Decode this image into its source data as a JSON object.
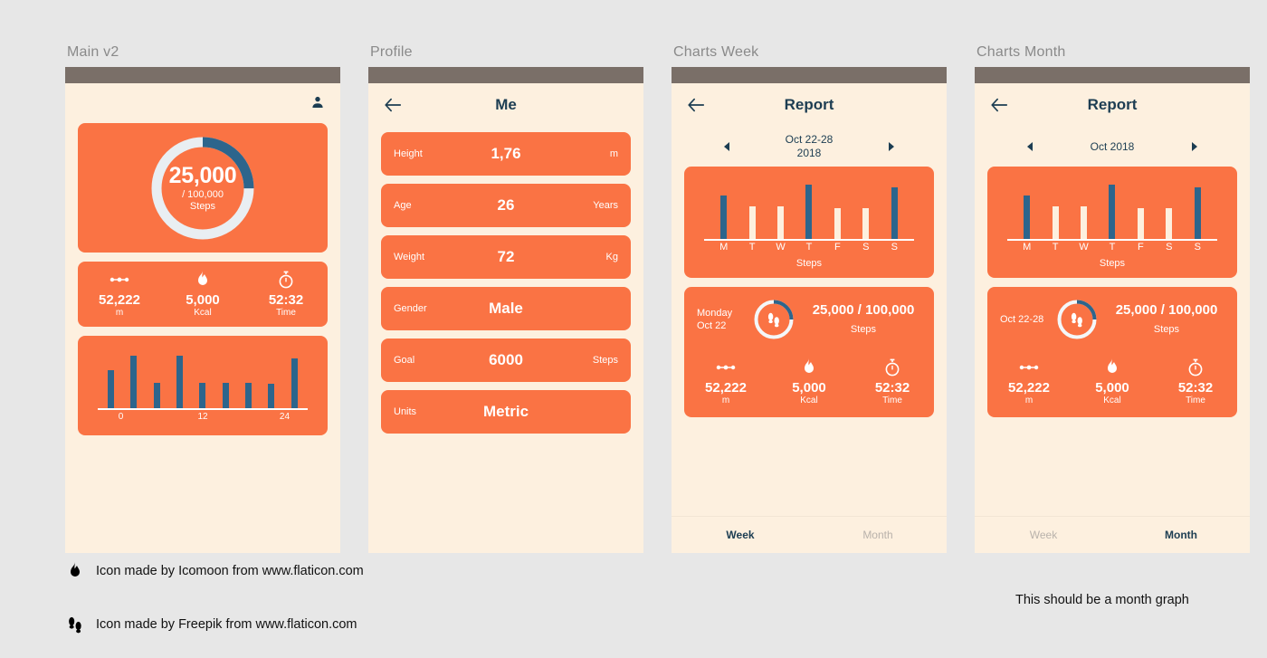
{
  "colors": {
    "background": "#e7e7e7",
    "phone_bg": "#fdf0df",
    "statusbar": "#7a6f68",
    "card_orange": "#fa7344",
    "accent_blue": "#2d658c",
    "navy_text": "#1c3d52",
    "muted_tab": "#b9b2ab"
  },
  "screens": [
    {
      "label": "Main v2",
      "profile_icon": "person-icon",
      "donut": {
        "value": "25,000",
        "goal": "/ 100,000",
        "unit": "Steps",
        "percent": 25
      },
      "stats": [
        {
          "icon": "distance-icon",
          "value": "52,222",
          "unit": "m"
        },
        {
          "icon": "flame-icon",
          "value": "5,000",
          "unit": "Kcal"
        },
        {
          "icon": "stopwatch-icon",
          "value": "52:32",
          "unit": "Time"
        }
      ]
    },
    {
      "label": "Profile",
      "nav": {
        "back": "back-arrow-icon",
        "title": "Me"
      },
      "rows": [
        {
          "label": "Height",
          "value": "1,76",
          "unit": "m"
        },
        {
          "label": "Age",
          "value": "26",
          "unit": "Years"
        },
        {
          "label": "Weight",
          "value": "72",
          "unit": "Kg"
        },
        {
          "label": "Gender",
          "value": "Male",
          "unit": ""
        },
        {
          "label": "Goal",
          "value": "6000",
          "unit": "Steps"
        },
        {
          "label": "Units",
          "value": "Metric",
          "unit": ""
        }
      ]
    },
    {
      "label": "Charts Week",
      "nav": {
        "back": "back-arrow-icon",
        "title": "Report"
      },
      "date": {
        "line1": "Oct 22-28",
        "line2": "2018",
        "prev": "prev-arrow-icon",
        "next": "next-arrow-icon"
      },
      "detail": {
        "date_line1": "Monday",
        "date_line2": "Oct 22",
        "steps": "25,000 / 100,000",
        "steps_label": "Steps",
        "ring_percent": 25,
        "stats": [
          {
            "icon": "distance-icon",
            "value": "52,222",
            "unit": "m"
          },
          {
            "icon": "flame-icon",
            "value": "5,000",
            "unit": "Kcal"
          },
          {
            "icon": "stopwatch-icon",
            "value": "52:32",
            "unit": "Time"
          }
        ]
      },
      "tabs": [
        {
          "label": "Week",
          "active": true
        },
        {
          "label": "Month",
          "active": false
        }
      ]
    },
    {
      "label": "Charts Month",
      "nav": {
        "back": "back-arrow-icon",
        "title": "Report"
      },
      "date": {
        "line1": "Oct 2018",
        "line2": "",
        "prev": "prev-arrow-icon",
        "next": "next-arrow-icon"
      },
      "detail": {
        "date_line1": "Oct 22-28",
        "date_line2": "",
        "steps": "25,000 / 100,000",
        "steps_label": "Steps",
        "ring_percent": 25,
        "stats": [
          {
            "icon": "distance-icon",
            "value": "52,222",
            "unit": "m"
          },
          {
            "icon": "flame-icon",
            "value": "5,000",
            "unit": "Kcal"
          },
          {
            "icon": "stopwatch-icon",
            "value": "52:32",
            "unit": "Time"
          }
        ]
      },
      "tabs": [
        {
          "label": "Week",
          "active": false
        },
        {
          "label": "Month",
          "active": true
        }
      ]
    }
  ],
  "footnotes": [
    {
      "icon": "flame-icon",
      "text": "Icon made by Icomoon from www.flaticon.com"
    },
    {
      "icon": "footsteps-icon",
      "text": "Icon made by Freepik from www.flaticon.com"
    }
  ],
  "note_right": "This should be a month graph",
  "chart_data": [
    {
      "type": "bar",
      "title": "",
      "name": "main-daily-steps",
      "categories": [
        "0",
        "",
        "",
        "",
        "",
        "12",
        "",
        "",
        "24"
      ],
      "xlabel": "",
      "ylabel": "",
      "tick_labels": [
        "0",
        "12",
        "24"
      ],
      "values": [
        42,
        58,
        28,
        58,
        28,
        28,
        28,
        27,
        55
      ],
      "ylim": [
        0,
        66
      ],
      "grid": false,
      "bar_color": "#2d658c",
      "legend": "none"
    },
    {
      "type": "bar",
      "name": "week-steps",
      "title": "Steps",
      "categories": [
        "M",
        "T",
        "W",
        "T",
        "F",
        "S",
        "S"
      ],
      "values": [
        48,
        36,
        36,
        60,
        34,
        34,
        57
      ],
      "colors": [
        "#2d658c",
        "#fdf0df",
        "#fdf0df",
        "#2d658c",
        "#fdf0df",
        "#fdf0df",
        "#2d658c"
      ],
      "xlabel": "",
      "ylabel": "Steps",
      "ylim": [
        0,
        66
      ],
      "grid": false,
      "legend": "none"
    },
    {
      "type": "bar",
      "name": "month-steps",
      "title": "Steps",
      "categories": [
        "M",
        "T",
        "W",
        "T",
        "F",
        "S",
        "S"
      ],
      "values": [
        48,
        36,
        36,
        60,
        34,
        34,
        57
      ],
      "colors": [
        "#2d658c",
        "#fdf0df",
        "#fdf0df",
        "#2d658c",
        "#fdf0df",
        "#fdf0df",
        "#2d658c"
      ],
      "xlabel": "",
      "ylabel": "Steps",
      "ylim": [
        0,
        66
      ],
      "grid": false,
      "legend": "none"
    }
  ]
}
